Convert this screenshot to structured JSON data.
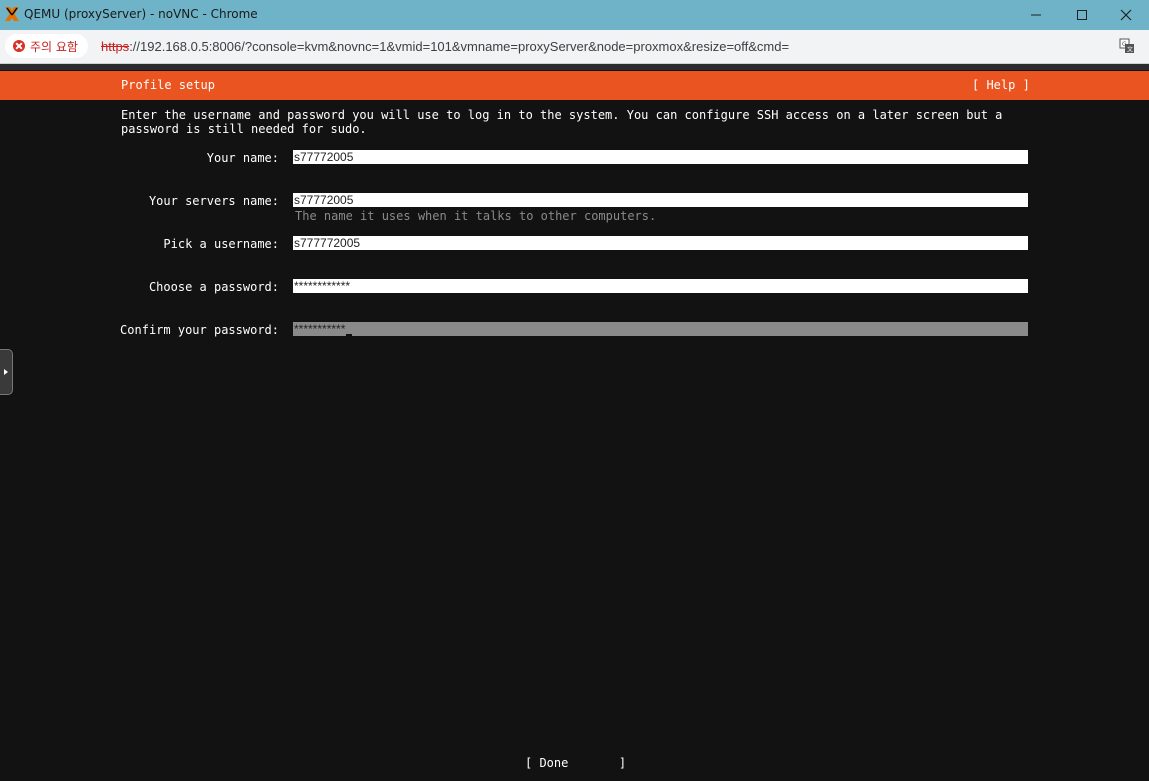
{
  "window": {
    "title": "QEMU (proxyServer) - noVNC - Chrome"
  },
  "addressbar": {
    "security_label": "주의 요함",
    "url_scheme": "https",
    "url_rest": "://192.168.0.5:8006/?console=kvm&novnc=1&vmid=101&vmname=proxyServer&node=proxmox&resize=off&cmd="
  },
  "installer": {
    "header_title": "Profile setup",
    "help_label": "[ Help ]",
    "intro_line1": "Enter the username and password you will use to log in to the system. You can configure SSH access on a later screen but a",
    "intro_line2": "password is still needed for sudo.",
    "fields": [
      {
        "label": "Your name:",
        "value": "s77772005"
      },
      {
        "label": "Your servers name:",
        "value": "s77772005",
        "hint": "The name it uses when it talks to other computers."
      },
      {
        "label": "Pick a username:",
        "value": "s777772005"
      },
      {
        "label": "Choose a password:",
        "value": "************"
      },
      {
        "label": "Confirm your password:",
        "value": "***********"
      }
    ],
    "done_label": "[ Done       ]"
  },
  "colors": {
    "header_orange": "#e95420",
    "terminal_bg": "#121212",
    "titlebar": "#6fb3c8"
  }
}
